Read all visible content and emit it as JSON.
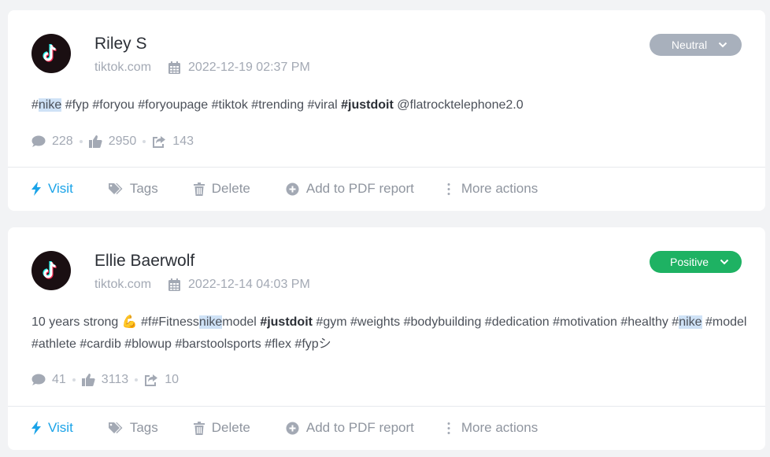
{
  "posts": [
    {
      "author": "Riley S",
      "source": "tiktok.com",
      "datetime": "2022-12-19 02:37 PM",
      "sentiment": "Neutral",
      "text_parts": {
        "p1": "#",
        "hl1": "nike",
        "p2": " #fyp #foryou #foryoupage #tiktok #trending #viral ",
        "bold1": "#justdoit",
        "p3": " @flatrocktelephone2.0"
      },
      "stats": {
        "comments": "228",
        "likes": "2950",
        "shares": "143"
      }
    },
    {
      "author": "Ellie Baerwolf",
      "source": "tiktok.com",
      "datetime": "2022-12-14 04:03 PM",
      "sentiment": "Positive",
      "text_parts": {
        "p1": "10 years strong ",
        "emoji": "💪",
        "p2": " #f#Fitness",
        "hl1": "nike",
        "p3": "model ",
        "bold1": "#justdoit",
        "p4": " #gym #weights #bodybuilding #dedication #motivation #healthy #",
        "hl2": "nike",
        "p5": " #model #athlete #cardib #blowup #barstoolsports #flex #fypシ"
      },
      "stats": {
        "comments": "41",
        "likes": "3113",
        "shares": "10"
      }
    }
  ],
  "actions": {
    "visit": "Visit",
    "tags": "Tags",
    "delete": "Delete",
    "add_pdf": "Add to PDF report",
    "more": "More actions"
  },
  "colors": {
    "neutral": "#a8b0bc",
    "positive": "#1eb263",
    "link": "#1aa3e8",
    "highlight": "#cfe2f6"
  }
}
